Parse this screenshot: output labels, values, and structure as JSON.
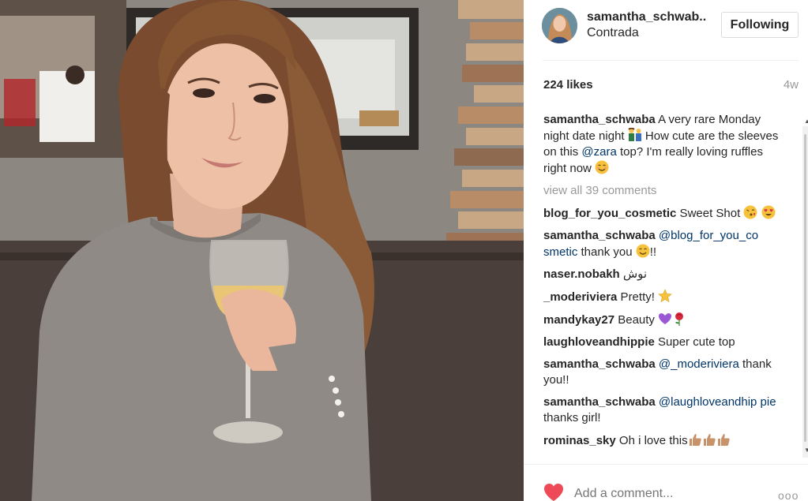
{
  "post": {
    "username": "samantha_schwab..",
    "location": "Contrada",
    "follow_label": "Following",
    "likes": "224 likes",
    "age": "4w"
  },
  "caption": {
    "user": "samantha_schwaba",
    "text_1": " A very rare Monday night date night ",
    "text_2": " How cute are the sleeves on this ",
    "mention": "@zara",
    "text_3": " top? I'm really loving ruffles right now "
  },
  "view_all": "view all 39 comments",
  "comments": [
    {
      "user": "blog_for_you_cosmetic",
      "text": " Sweet Shot "
    },
    {
      "user": "samantha_schwaba",
      "mention": " @blog_for_you_co smetic",
      "text": " thank you ",
      "text_after": "!!"
    },
    {
      "user": "naser.nobakh",
      "text": " نوش"
    },
    {
      "user": "_moderiviera",
      "text": " Pretty! "
    },
    {
      "user": "mandykay27",
      "text": " Beauty "
    },
    {
      "user": "laughloveandhippie",
      "text": " Super cute top"
    },
    {
      "user": "samantha_schwaba",
      "mention": " @_moderiviera",
      "text": " thank you!!"
    },
    {
      "user": "samantha_schwaba",
      "mention": " @laughloveandhip pie",
      "text": " thanks girl!"
    },
    {
      "user": "rominas_sky",
      "text": " Oh i love this"
    }
  ],
  "footer": {
    "add_comment_placeholder": "Add a comment...",
    "more_label": "ooo"
  },
  "colors": {
    "heart": "#ed4956",
    "mention": "#003569",
    "muted": "#999999",
    "border": "#dbdbdb"
  },
  "icons": [
    "heart-icon",
    "more-options-icon",
    "couple-emoji",
    "blush-emoji",
    "kiss-emoji",
    "heart-eyes-emoji",
    "smile-emoji",
    "star-emoji",
    "purple-heart-emoji",
    "rose-emoji",
    "thumbs-up-emoji"
  ]
}
